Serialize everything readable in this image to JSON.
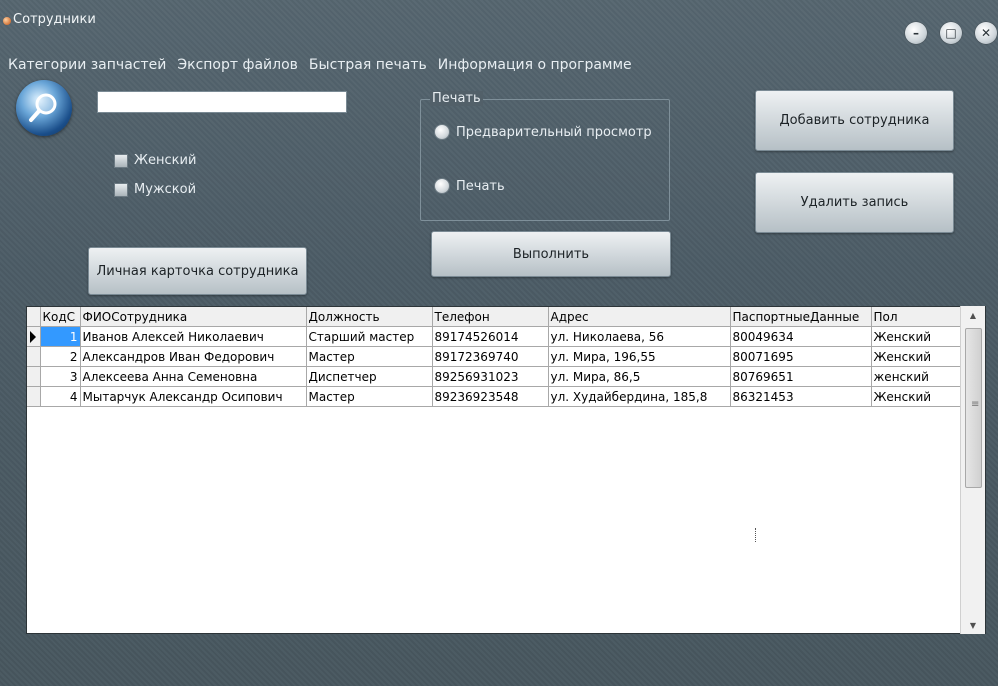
{
  "window": {
    "title": "Сотрудники",
    "minimize_glyph": "–",
    "maximize_glyph": "□",
    "close_glyph": "✕"
  },
  "menu": {
    "items": [
      "Категории запчастей",
      "Экспорт файлов",
      "Быстрая печать",
      "Информация о программе"
    ]
  },
  "search": {
    "value": ""
  },
  "gender_filters": [
    {
      "label": "Женский",
      "checked": false
    },
    {
      "label": "Мужской",
      "checked": false
    }
  ],
  "print_group": {
    "legend": "Печать",
    "options": [
      {
        "label": "Предварительный просмотр",
        "selected": false
      },
      {
        "label": "Печать",
        "selected": false
      }
    ]
  },
  "buttons": {
    "add_employee": "Добавить сотрудника",
    "delete_record": "Удалить запись",
    "execute": "Выполнить",
    "personal_card": "Личная карточка сотрудника"
  },
  "table": {
    "columns": [
      "КодС",
      "ФИОСотрудника",
      "Должность",
      "Телефон",
      "Адрес",
      "ПаспортныеДанные",
      "Пол"
    ],
    "rows": [
      [
        "1",
        "Иванов Алексей Николаевич",
        "Старший мастер",
        "89174526014",
        "ул. Николаева, 56",
        "80049634",
        "Женский"
      ],
      [
        "2",
        "Александров Иван Федорович",
        "Мастер",
        "89172369740",
        "ул. Мира, 196,55",
        "80071695",
        "Женский"
      ],
      [
        "3",
        "Алексеева Анна Семеновна",
        "Диспетчер",
        "89256931023",
        "ул. Мира, 86,5",
        "80769651",
        "женский"
      ],
      [
        "4",
        "Мытарчук Александр Осипович",
        "Мастер",
        "89236923548",
        "ул. Худайбердина, 185,8",
        "86321453",
        "Женский"
      ]
    ],
    "selected_row": 0
  },
  "icons": {
    "search": "magnifier-icon",
    "app": "app-icon"
  }
}
